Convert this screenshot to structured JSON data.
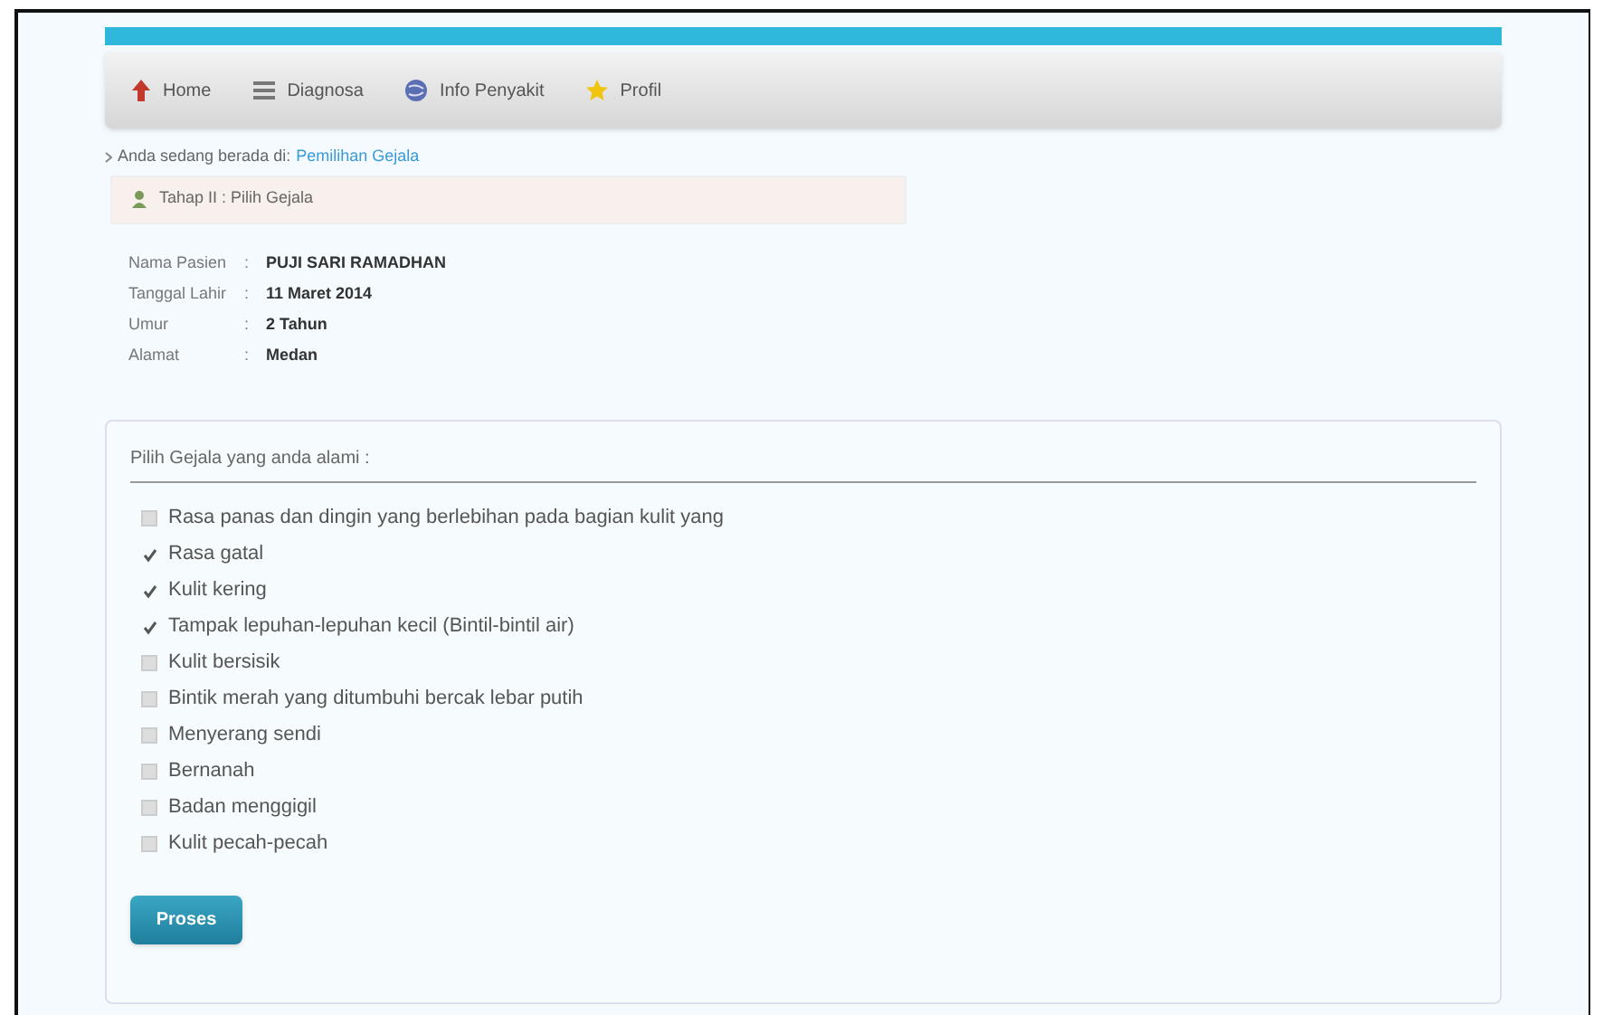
{
  "nav": [
    {
      "label": "Home"
    },
    {
      "label": "Diagnosa"
    },
    {
      "label": "Info Penyakit"
    },
    {
      "label": "Profil"
    }
  ],
  "breadcrumb": {
    "prefix": "Anda sedang berada di:",
    "link": "Pemilihan Gejala"
  },
  "step": "Tahap II : Pilih Gejala",
  "patient": [
    {
      "label": "Nama Pasien",
      "separator": ":",
      "value": "PUJI SARI RAMADHAN"
    },
    {
      "label": "Tanggal Lahir",
      "separator": ":",
      "value": "11 Maret 2014"
    },
    {
      "label": "Umur",
      "separator": ":",
      "value": "2 Tahun"
    },
    {
      "label": "Alamat",
      "separator": ":",
      "value": "Medan"
    }
  ],
  "symptoms": {
    "heading": "Pilih Gejala yang anda alami :",
    "items": [
      {
        "label": "Rasa panas dan dingin yang berlebihan pada bagian kulit yang",
        "checked": false
      },
      {
        "label": "Rasa gatal",
        "checked": true
      },
      {
        "label": "Kulit kering",
        "checked": true
      },
      {
        "label": "Tampak lepuhan-lepuhan kecil (Bintil-bintil air)",
        "checked": true
      },
      {
        "label": "Kulit bersisik",
        "checked": false
      },
      {
        "label": "Bintik merah yang ditumbuhi bercak lebar putih",
        "checked": false
      },
      {
        "label": "Menyerang sendi",
        "checked": false
      },
      {
        "label": "Bernanah",
        "checked": false
      },
      {
        "label": "Badan menggigil",
        "checked": false
      },
      {
        "label": "Kulit pecah-pecah",
        "checked": false
      }
    ],
    "button": "Proses"
  }
}
